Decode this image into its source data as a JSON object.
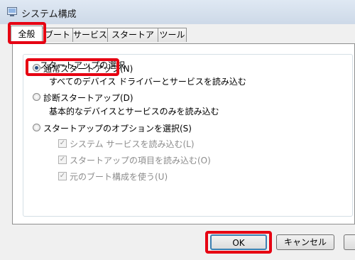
{
  "window": {
    "title": "システム構成",
    "icon": "system-config-icon"
  },
  "tabs": [
    {
      "label": "全般",
      "active": true
    },
    {
      "label": "ブート",
      "active": false
    },
    {
      "label": "サービス",
      "active": false
    },
    {
      "label": "スタートアップ",
      "active": false
    },
    {
      "label": "ツール",
      "active": false
    }
  ],
  "startup_group": {
    "title": "スタートアップの選択",
    "options": [
      {
        "label": "通常スタートアップ(N)",
        "description": "すべてのデバイス ドライバーとサービスを読み込む",
        "selected": true
      },
      {
        "label": "診断スタートアップ(D)",
        "description": "基本的なデバイスとサービスのみを読み込む",
        "selected": false
      },
      {
        "label": "スタートアップのオプションを選択(S)",
        "selected": false
      }
    ],
    "sub_options": [
      {
        "label": "システム サービスを読み込む(L)",
        "checked": true,
        "enabled": false
      },
      {
        "label": "スタートアップの項目を読み込む(O)",
        "checked": true,
        "enabled": false
      },
      {
        "label": "元のブート構成を使う(U)",
        "checked": true,
        "enabled": false
      }
    ]
  },
  "buttons": {
    "ok": "OK",
    "cancel": "キャンセル"
  },
  "highlight_color": "#e60012"
}
